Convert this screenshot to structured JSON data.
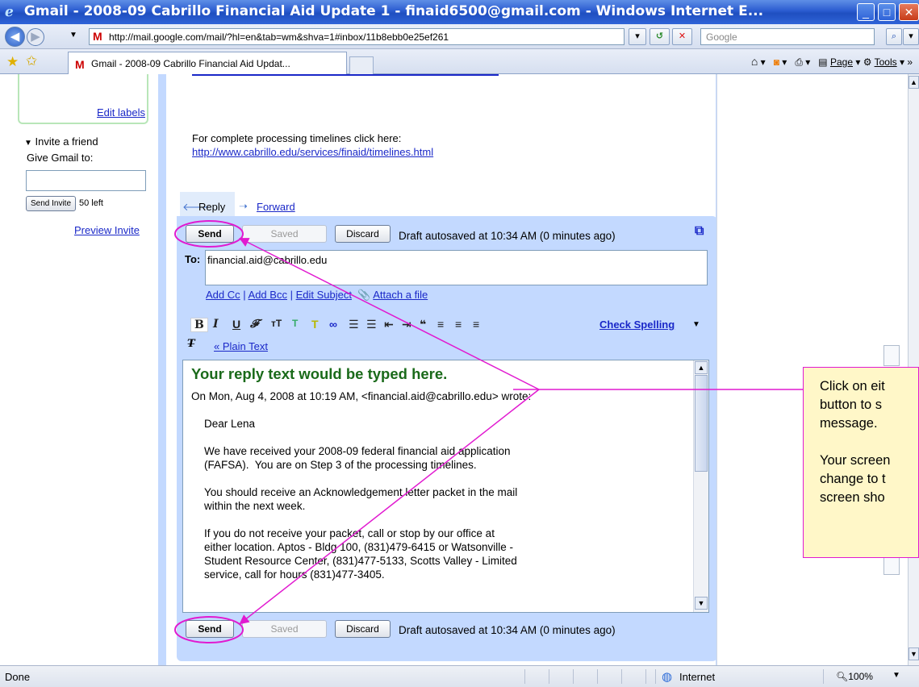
{
  "window": {
    "title": "Gmail - 2008-09 Cabrillo Financial Aid Update 1 - finaid6500@gmail.com - Windows Internet E..."
  },
  "address_bar": {
    "url": "http://mail.google.com/mail/?hl=en&tab=wm&shva=1#inbox/11b8ebb0e25ef261",
    "search_placeholder": "Google"
  },
  "tabs": [
    {
      "label": "Gmail - 2008-09 Cabrillo Financial Aid Updat..."
    }
  ],
  "command_bar": {
    "page_label": "Page",
    "tools_label": "Tools",
    "more": "»"
  },
  "sidebar": {
    "edit_labels": "Edit labels",
    "invite_heading": "Invite a friend",
    "give_gmail_to": "Give Gmail to:",
    "send_invite": "Send Invite",
    "invites_left": "50 left",
    "preview_invite": "Preview Invite"
  },
  "message": {
    "timelines_intro": "For complete processing timelines click here:",
    "timelines_link": "http://www.cabrillo.edu/services/finaid/timelines.html"
  },
  "compose": {
    "reply_label": "Reply",
    "forward_label": "Forward",
    "send_label": "Send",
    "saved_label": "Saved",
    "discard_label": "Discard",
    "autosave_status": "Draft autosaved at 10:34 AM (0 minutes ago)",
    "to_label": "To:",
    "to_value": "financial.aid@cabrillo.edu",
    "add_cc": "Add Cc",
    "add_bcc": "Add Bcc",
    "edit_subject": "Edit Subject",
    "attach_file": "Attach a file",
    "check_spelling": "Check Spelling",
    "plain_text": "« Plain Text",
    "reply_placeholder": "Your reply text would be typed here.",
    "quote_header": "On Mon, Aug 4, 2008 at 10:19 AM, <financial.aid@cabrillo.edu> wrote:",
    "quote_lines": [
      "Dear Lena",
      "",
      "We have received your 2008-09 federal financial aid application",
      "(FAFSA).  You are on Step 3 of the processing timelines.",
      "",
      "You should receive an Acknowledgement letter packet in the mail",
      "within the next week.",
      "",
      "If you do not receive your packet, call or stop by our office at",
      "either location. Aptos - Bldg 100, (831)479-6415 or Watsonville -",
      "Student Resource Center, (831)477-5133, Scotts Valley - Limited",
      "service, call for hours (831)477-3405."
    ]
  },
  "callout": {
    "text": "Click on eit\nbutton to s\nmessage.\n\nYour screen\nchange to t\nscreen sho",
    "border_color": "#e11ad0"
  },
  "status_bar": {
    "status": "Done",
    "zone": "Internet",
    "zoom": "100%"
  }
}
